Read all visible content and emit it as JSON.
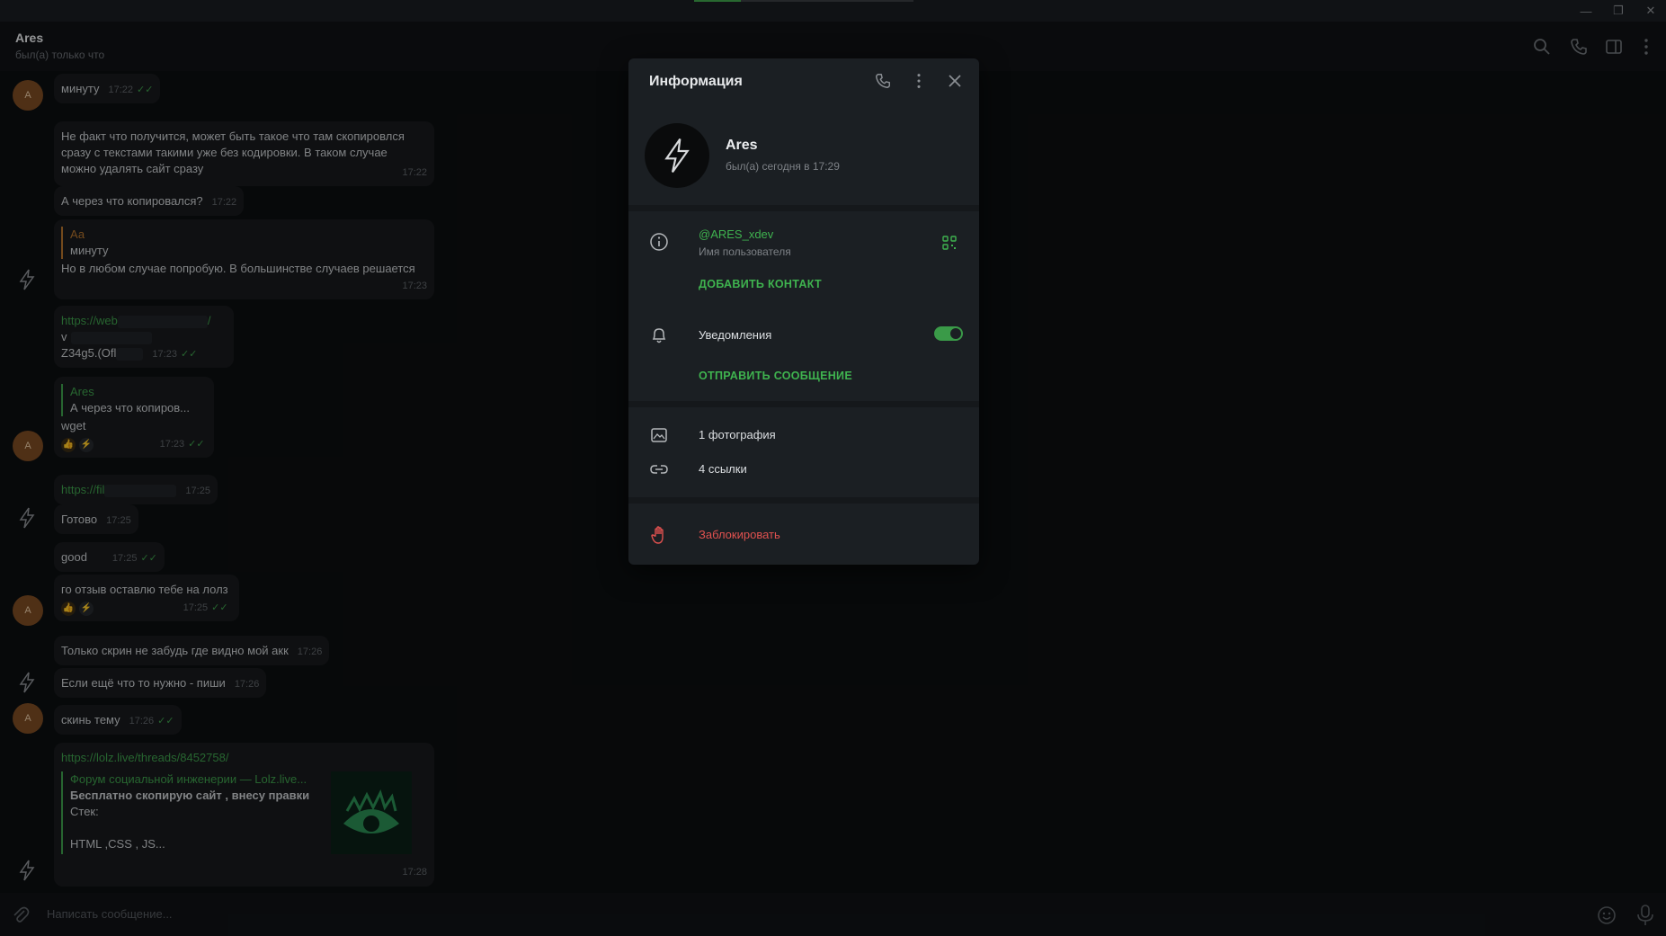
{
  "window": {
    "min_label": "—",
    "max_label": "❐",
    "close_label": "✕"
  },
  "chat": {
    "name": "Ares",
    "status": "был(а) только что",
    "composer_placeholder": "Написать сообщение..."
  },
  "messages": [
    {
      "text": "минуту",
      "time": "17:22",
      "read": "✓✓"
    },
    {
      "lines": [
        "Не факт что получится, может быть такое что там скопировлся",
        "сразу с текстами такими уже без кодировки. В таком случае",
        "можно удалять сайт сразу"
      ],
      "time": "17:22"
    },
    {
      "text": "А через что копировался?",
      "time": "17:22"
    },
    {
      "quote_name": "Аа",
      "quote_text": "минуту",
      "text": "Но в любом случае попробую. В большинстве случаев решается",
      "time": "17:23"
    },
    {
      "link": "https://web",
      "link_end": "/",
      "line2": "v",
      "line3": "Z34g5.(Ofl",
      "time": "17:23",
      "read": "✓✓"
    },
    {
      "quote_name": "Ares",
      "quote_text": "А через что копиров...",
      "text": "wget",
      "time": "17:23",
      "read": "✓✓"
    },
    {
      "link": "https://fil",
      "time": "17:25"
    },
    {
      "text": "Готово",
      "time": "17:25"
    },
    {
      "text": "good",
      "time": "17:25",
      "read": "✓✓"
    },
    {
      "text": "го отзыв оставлю тебе на лолз",
      "time": "17:25",
      "read": "✓✓"
    },
    {
      "text": "Только скрин не забудь где видно мой акк",
      "time": "17:26"
    },
    {
      "text": "Если ещё что то нужно - пиши",
      "time": "17:26"
    },
    {
      "text": "скинь тему",
      "time": "17:26",
      "read": "✓✓"
    },
    {
      "link": "https://lolz.live/threads/8452758/",
      "preview_site": "Форум социальной инженерии — Lolz.live...",
      "preview_title": "Бесплатно скопирую сайт , внесу правки",
      "preview_line1": "Стек:",
      "preview_line2": "HTML ,CSS , JS...",
      "time": "17:28"
    }
  ],
  "avatar_letter": "A",
  "reactions": {
    "first": "👍",
    "second": "⚡"
  },
  "info": {
    "title": "Информация",
    "name": "Ares",
    "seen": "был(а) сегодня в 17:29",
    "username": "@ARES_xdev",
    "username_label": "Имя пользователя",
    "add_contact": "ДОБАВИТЬ КОНТАКТ",
    "notifications_label": "Уведомления",
    "notifications_on": true,
    "send_message": "ОТПРАВИТЬ СООБЩЕНИЕ",
    "photos": "1 фотография",
    "links": "4 ссылки",
    "block": "Заблокировать"
  },
  "colors": {
    "accent": "#3fb34f",
    "danger": "#e0514f",
    "avatar": "#7a4a22"
  }
}
